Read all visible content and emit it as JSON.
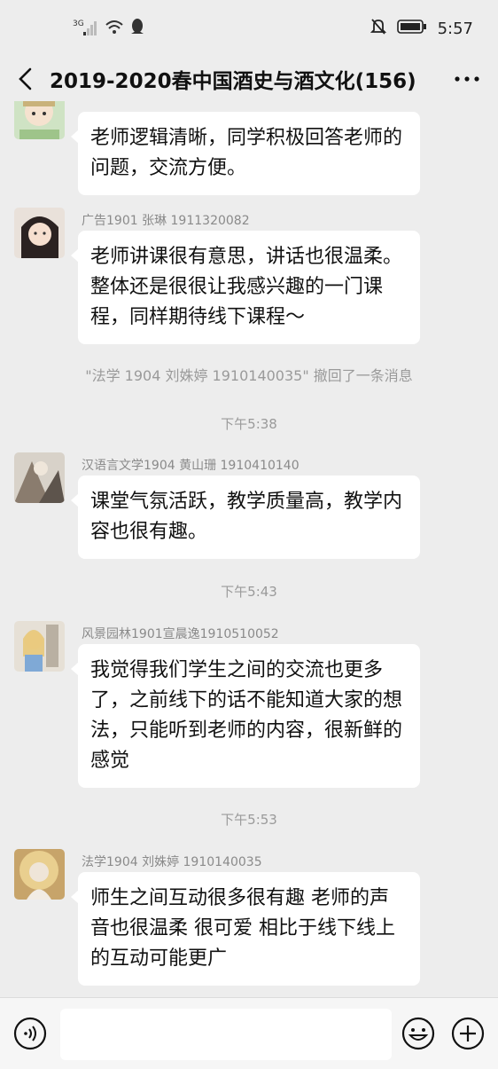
{
  "status": {
    "signal_label": "3G",
    "time": "5:57"
  },
  "header": {
    "title": "2019-2020春中国酒史与酒文化(156)"
  },
  "messages": [
    {
      "sender": "",
      "text": "老师逻辑清晰，同学积极回答老师的问题，交流方便。"
    },
    {
      "sender": "广告1901 张琳 1911320082",
      "text": "老师讲课很有意思，讲话也很温柔。整体还是很很让我感兴趣的一门课程，同样期待线下课程～"
    },
    {
      "sender": "汉语言文学1904 黄山珊 1910410140",
      "text": "课堂气氛活跃，教学质量高，教学内容也很有趣。"
    },
    {
      "sender": "风景园林1901宣晨逸1910510052",
      "text": "我觉得我们学生之间的交流也更多了，之前线下的话不能知道大家的想法，只能听到老师的内容，很新鲜的感觉"
    },
    {
      "sender": "法学1904 刘姝婷 1910140035",
      "text": "师生之间互动很多很有趣  老师的声音也很温柔 很可爱 相比于线下线上的互动可能更广"
    }
  ],
  "system": {
    "recall": "\"法学 1904 刘姝婷 1910140035\" 撤回了一条消息",
    "time1": "下午5:38",
    "time2": "下午5:43",
    "time3": "下午5:53"
  },
  "input": {
    "value": ""
  },
  "colors": {
    "background": "#ededed",
    "bubble": "#ffffff",
    "timestamp": "#9a9a9a"
  },
  "icons": [
    "back-arrow-icon",
    "more-icon",
    "voice-icon",
    "emoji-icon",
    "plus-icon",
    "bell-muted-icon",
    "battery-icon",
    "wifi-icon",
    "signal-icon",
    "qq-icon"
  ]
}
